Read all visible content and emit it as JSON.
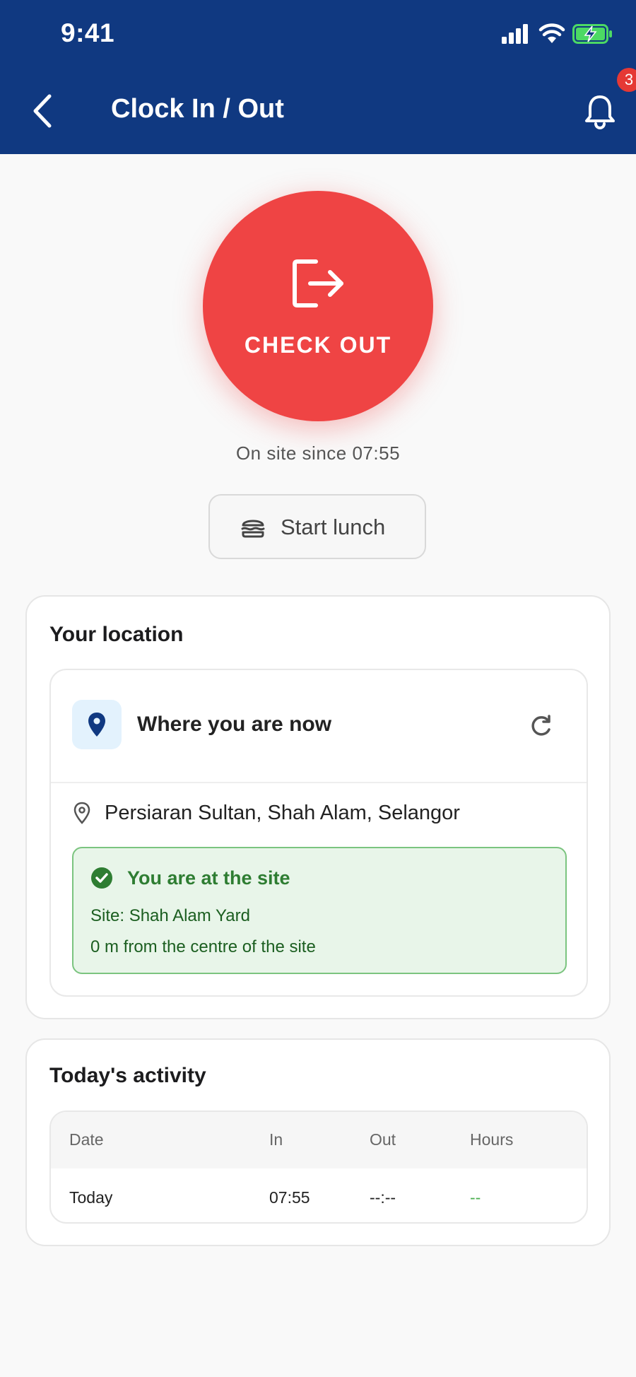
{
  "status_bar": {
    "time": "9:41"
  },
  "header": {
    "title": "Clock In / Out",
    "notification_count": "3"
  },
  "checkout": {
    "label": "CHECK OUT",
    "since": "On site since 07:55"
  },
  "lunch": {
    "label": "Start lunch"
  },
  "location": {
    "title": "Your location",
    "where_label": "Where you are now",
    "address": "Persiaran Sultan, Shah Alam, Selangor",
    "status": "You are at the site",
    "site_name": "Site: Shah Alam Yard",
    "distance": "0 m from the centre of the site"
  },
  "activity": {
    "title": "Today's activity",
    "columns": [
      "Date",
      "In",
      "Out",
      "Hours"
    ],
    "rows": [
      {
        "date": "Today",
        "in": "07:55",
        "out": "--:--",
        "hours": "--"
      }
    ]
  },
  "colors": {
    "header": "#103981",
    "checkout": "#ef4444",
    "success": "#2e7d32",
    "hours_placeholder": "#4caf50"
  }
}
